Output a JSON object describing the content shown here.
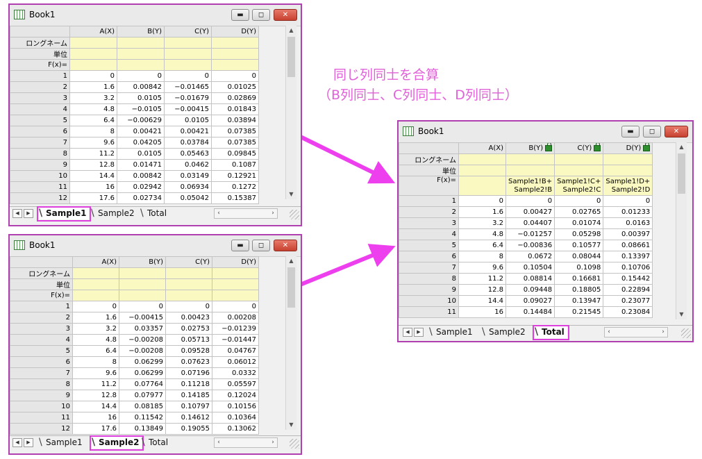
{
  "annotation": {
    "line1": "同じ列同士を合算",
    "line2": "（B列同士、C列同士、D列同士）",
    "color": "#e061d8"
  },
  "colors": {
    "accent": "#dc3fdc",
    "meta_row": "#fbf9c2",
    "window_border": "#b03fb0"
  },
  "window_controls": {
    "minimize": "▬",
    "maximize": "◻",
    "close": "✕"
  },
  "windows": [
    {
      "id": "w1",
      "title": "Book1",
      "columns": [
        "A(X)",
        "B(Y)",
        "C(Y)",
        "D(Y)"
      ],
      "meta_labels": [
        "ロングネーム",
        "単位",
        "F(x)="
      ],
      "fx": [
        "",
        "",
        "",
        ""
      ],
      "rows": [
        [
          "1",
          "0",
          "0",
          "0",
          "0"
        ],
        [
          "2",
          "1.6",
          "0.00842",
          "−0.01465",
          "0.01025"
        ],
        [
          "3",
          "3.2",
          "0.0105",
          "−0.01679",
          "0.02869"
        ],
        [
          "4",
          "4.8",
          "−0.0105",
          "−0.00415",
          "0.01843"
        ],
        [
          "5",
          "6.4",
          "−0.00629",
          "0.0105",
          "0.03894"
        ],
        [
          "6",
          "8",
          "0.00421",
          "0.00421",
          "0.07385"
        ],
        [
          "7",
          "9.6",
          "0.04205",
          "0.03784",
          "0.07385"
        ],
        [
          "8",
          "11.2",
          "0.0105",
          "0.05463",
          "0.09845"
        ],
        [
          "9",
          "12.8",
          "0.01471",
          "0.0462",
          "0.1087"
        ],
        [
          "10",
          "14.4",
          "0.00842",
          "0.03149",
          "0.12921"
        ],
        [
          "11",
          "16",
          "0.02942",
          "0.06934",
          "0.1272"
        ],
        [
          "12",
          "17.6",
          "0.02734",
          "0.05042",
          "0.15387"
        ]
      ],
      "tabs": [
        "Sample1",
        "Sample2",
        "Total"
      ],
      "active_tab": 0
    },
    {
      "id": "w2",
      "title": "Book1",
      "columns": [
        "A(X)",
        "B(Y)",
        "C(Y)",
        "D(Y)"
      ],
      "meta_labels": [
        "ロングネーム",
        "単位",
        "F(x)="
      ],
      "fx": [
        "",
        "",
        "",
        ""
      ],
      "rows": [
        [
          "1",
          "0",
          "0",
          "0",
          "0"
        ],
        [
          "2",
          "1.6",
          "−0.00415",
          "0.00423",
          "0.00208"
        ],
        [
          "3",
          "3.2",
          "0.03357",
          "0.02753",
          "−0.01239"
        ],
        [
          "4",
          "4.8",
          "−0.00208",
          "0.05713",
          "−0.01447"
        ],
        [
          "5",
          "6.4",
          "−0.00208",
          "0.09528",
          "0.04767"
        ],
        [
          "6",
          "8",
          "0.06299",
          "0.07623",
          "0.06012"
        ],
        [
          "7",
          "9.6",
          "0.06299",
          "0.07196",
          "0.0332"
        ],
        [
          "8",
          "11.2",
          "0.07764",
          "0.11218",
          "0.05597"
        ],
        [
          "9",
          "12.8",
          "0.07977",
          "0.14185",
          "0.12024"
        ],
        [
          "10",
          "14.4",
          "0.08185",
          "0.10797",
          "0.10156"
        ],
        [
          "11",
          "16",
          "0.11542",
          "0.14612",
          "0.10364"
        ],
        [
          "12",
          "17.6",
          "0.13849",
          "0.19055",
          "0.13062"
        ]
      ],
      "tabs": [
        "Sample1",
        "Sample2",
        "Total"
      ],
      "active_tab": 1
    },
    {
      "id": "w3",
      "title": "Book1",
      "columns": [
        "A(X)",
        "B(Y)",
        "C(Y)",
        "D(Y)"
      ],
      "meta_labels": [
        "ロングネーム",
        "単位",
        "F(x)="
      ],
      "fx": [
        "",
        "Sample1!B+\nSample2!B",
        "Sample1!C+\nSample2!C",
        "Sample1!D+\nSample2!D"
      ],
      "rows": [
        [
          "1",
          "0",
          "0",
          "0",
          "0"
        ],
        [
          "2",
          "1.6",
          "0.00427",
          "0.02765",
          "0.01233"
        ],
        [
          "3",
          "3.2",
          "0.04407",
          "0.01074",
          "0.0163"
        ],
        [
          "4",
          "4.8",
          "−0.01257",
          "0.05298",
          "0.00397"
        ],
        [
          "5",
          "6.4",
          "−0.00836",
          "0.10577",
          "0.08661"
        ],
        [
          "6",
          "8",
          "0.0672",
          "0.08044",
          "0.13397"
        ],
        [
          "7",
          "9.6",
          "0.10504",
          "0.1098",
          "0.10706"
        ],
        [
          "8",
          "11.2",
          "0.08814",
          "0.16681",
          "0.15442"
        ],
        [
          "9",
          "12.8",
          "0.09448",
          "0.18805",
          "0.22894"
        ],
        [
          "10",
          "14.4",
          "0.09027",
          "0.13947",
          "0.23077"
        ],
        [
          "11",
          "16",
          "0.14484",
          "0.21545",
          "0.23084"
        ]
      ],
      "tabs": [
        "Sample1",
        "Sample2",
        "Total"
      ],
      "active_tab": 2
    }
  ]
}
